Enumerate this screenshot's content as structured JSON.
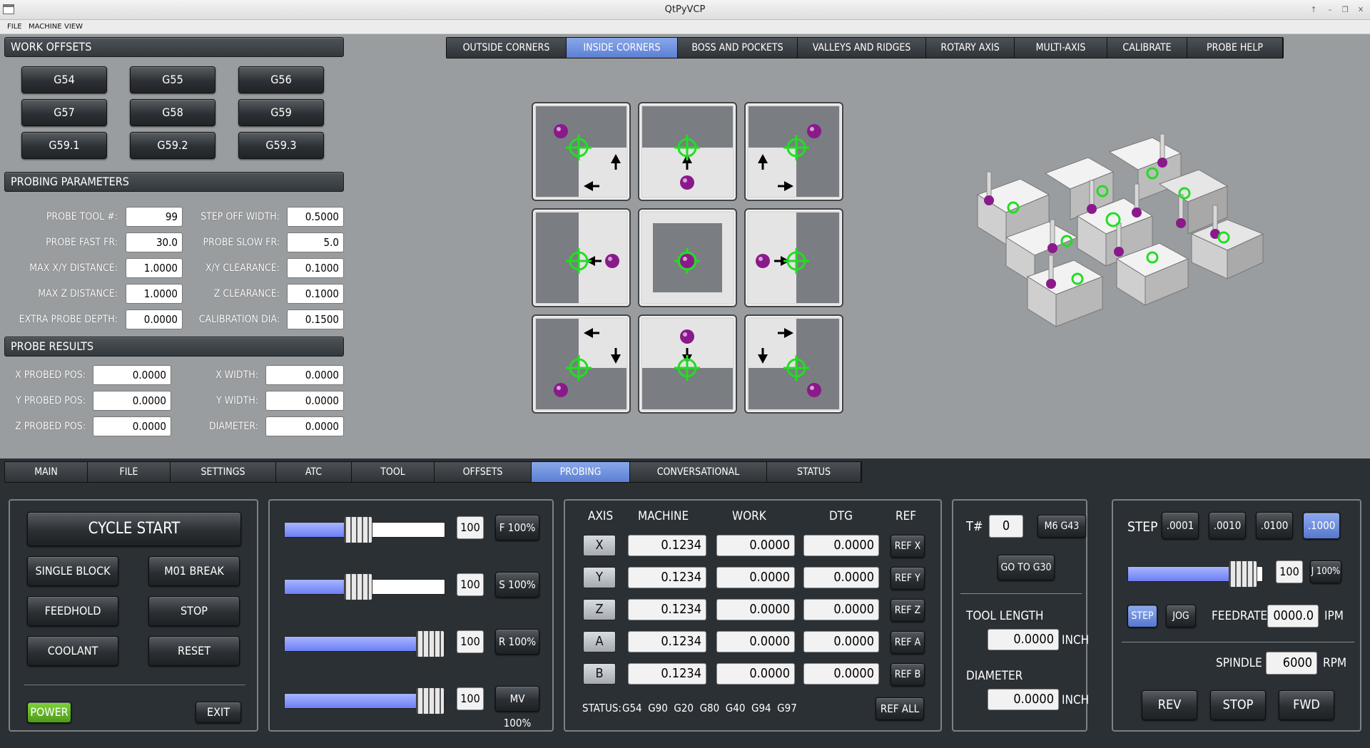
{
  "window": {
    "title": "QtPyVCP"
  },
  "menu": [
    "FILE",
    "MACHINE",
    "VIEW"
  ],
  "work_offsets": {
    "title": "WORK OFFSETS",
    "buttons": [
      "G54",
      "G55",
      "G56",
      "G57",
      "G58",
      "G59",
      "G59.1",
      "G59.2",
      "G59.3"
    ]
  },
  "probing_params": {
    "title": "PROBING PARAMETERS",
    "rows": [
      {
        "label": "PROBE TOOL #:",
        "value": "99",
        "label2": "STEP OFF WIDTH:",
        "value2": "0.5000"
      },
      {
        "label": "PROBE FAST FR:",
        "value": "30.0",
        "label2": "PROBE SLOW FR:",
        "value2": "5.0"
      },
      {
        "label": "MAX X/Y DISTANCE:",
        "value": "1.0000",
        "label2": "X/Y CLEARANCE:",
        "value2": "0.1000"
      },
      {
        "label": "MAX Z DISTANCE:",
        "value": "1.0000",
        "label2": "Z CLEARANCE:",
        "value2": "0.1000"
      },
      {
        "label": "EXTRA PROBE DEPTH:",
        "value": "0.0000",
        "label2": "CALIBRATION DIA:",
        "value2": "0.1500"
      }
    ]
  },
  "probe_results": {
    "title": "PROBE RESULTS",
    "rows": [
      {
        "label": "X PROBED POS:",
        "value": "0.0000",
        "label2": "X WIDTH:",
        "value2": "0.0000"
      },
      {
        "label": "Y PROBED POS:",
        "value": "0.0000",
        "label2": "Y WIDTH:",
        "value2": "0.0000"
      },
      {
        "label": "Z PROBED POS:",
        "value": "0.0000",
        "label2": "DIAMETER:",
        "value2": "0.0000"
      }
    ]
  },
  "probe_tabs": {
    "items": [
      "OUTSIDE CORNERS",
      "INSIDE CORNERS",
      "BOSS AND POCKETS",
      "VALLEYS AND RIDGES",
      "ROTARY AXIS",
      "MULTI-AXIS",
      "CALIBRATE",
      "PROBE HELP"
    ],
    "active": 1
  },
  "main_tabs": {
    "items": [
      "MAIN",
      "FILE",
      "SETTINGS",
      "ATC",
      "TOOL",
      "OFFSETS",
      "PROBING",
      "CONVERSATIONAL",
      "STATUS"
    ],
    "active": 6
  },
  "controls": {
    "cycle_start": "CYCLE START",
    "single_block": "SINGLE BLOCK",
    "m01_break": "M01 BREAK",
    "feedhold": "FEEDHOLD",
    "stop": "STOP",
    "coolant": "COOLANT",
    "reset": "RESET",
    "power": "POWER",
    "exit": "EXIT"
  },
  "overrides": [
    {
      "value": "100",
      "button": "F 100%",
      "level": 0.45
    },
    {
      "value": "100",
      "button": "S 100%",
      "level": 0.45
    },
    {
      "value": "100",
      "button": "R 100%",
      "level": 1.0
    },
    {
      "value": "100",
      "button": "MV 100%",
      "level": 1.0
    }
  ],
  "dro": {
    "headers": [
      "AXIS",
      "MACHINE",
      "WORK",
      "DTG",
      "REF"
    ],
    "rows": [
      {
        "axis": "X",
        "machine": "0.1234",
        "work": "0.0000",
        "dtg": "0.0000",
        "ref": "REF X"
      },
      {
        "axis": "Y",
        "machine": "0.1234",
        "work": "0.0000",
        "dtg": "0.0000",
        "ref": "REF Y"
      },
      {
        "axis": "Z",
        "machine": "0.1234",
        "work": "0.0000",
        "dtg": "0.0000",
        "ref": "REF Z"
      },
      {
        "axis": "A",
        "machine": "0.1234",
        "work": "0.0000",
        "dtg": "0.0000",
        "ref": "REF A"
      },
      {
        "axis": "B",
        "machine": "0.1234",
        "work": "0.0000",
        "dtg": "0.0000",
        "ref": "REF B"
      }
    ],
    "status_label": "STATUS:",
    "status_codes": "G54  G90  G20  G80  G40  G94  G97",
    "ref_all": "REF ALL"
  },
  "tool": {
    "t_label": "T#",
    "t_value": "0",
    "m6": "M6 G43",
    "g30": "GO TO G30",
    "length_label": "TOOL LENGTH",
    "length_value": "0.0000",
    "length_unit": "INCH",
    "dia_label": "DIAMETER",
    "dia_value": "0.0000",
    "dia_unit": "INCH"
  },
  "jog": {
    "step_label": "STEP",
    "steps": [
      ".0001",
      ".0010",
      ".0100",
      ".1000"
    ],
    "active_step": 3,
    "slider_value": "100",
    "jog_button": "J 100%",
    "jog_level": 0.95,
    "mode_step": "STEP",
    "mode_jog": "JOG",
    "feedrate_label": "FEEDRATE",
    "feedrate_value": "0000.0",
    "feedrate_unit": "IPM",
    "spindle_label": "SPINDLE",
    "spindle_value": "6000",
    "spindle_unit": "RPM",
    "rev": "REV",
    "stop": "STOP",
    "fwd": "FWD"
  },
  "colors": {
    "accent": "#5b7fd4",
    "power": "#58a820",
    "probe_target": "#22dd22",
    "probe_ball": "#8a1a8a"
  }
}
